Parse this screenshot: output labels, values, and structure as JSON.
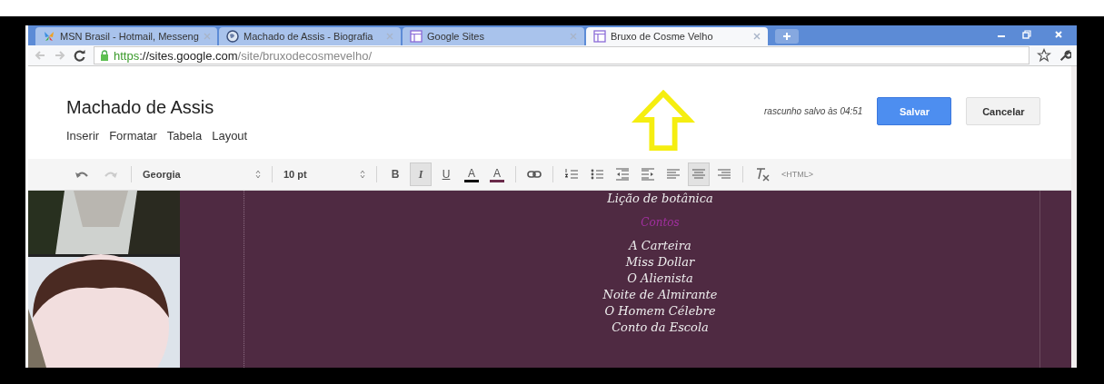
{
  "tabs": [
    {
      "title": "MSN Brasil - Hotmail, Messeng",
      "selected": false
    },
    {
      "title": "Machado de Assis - Biografia",
      "selected": false
    },
    {
      "title": "Google Sites",
      "selected": false
    },
    {
      "title": "Bruxo de Cosme Velho",
      "selected": true
    }
  ],
  "address": {
    "scheme": "https",
    "host": "://sites.google.com",
    "path": "/site/bruxodecosmevelho/"
  },
  "site_title": "Machado de Assis",
  "menu": [
    {
      "label": "Inserir"
    },
    {
      "label": "Formatar"
    },
    {
      "label": "Tabela"
    },
    {
      "label": "Layout"
    }
  ],
  "draft_status": "rascunho salvo às 04:51",
  "buttons": [
    {
      "label": "Salvar",
      "kind": "primary"
    },
    {
      "label": "Cancelar",
      "kind": "secondary"
    }
  ],
  "toolbar": {
    "font": "Georgia",
    "size": "10 pt",
    "html": "<HTML>",
    "tools": [
      {
        "kind": "bold",
        "label": "B",
        "selected": false
      },
      {
        "kind": "italic",
        "label": "I",
        "selected": true
      },
      {
        "kind": "underline",
        "label": "U",
        "selected": false
      },
      {
        "kind": "color",
        "label": "A",
        "selected": false
      },
      {
        "kind": "highlight",
        "label": "A",
        "selected": false
      },
      {
        "kind": "link",
        "selected": false
      },
      {
        "kind": "numbered",
        "selected": false
      },
      {
        "kind": "bulleted",
        "selected": false
      },
      {
        "kind": "outdent",
        "selected": false
      },
      {
        "kind": "indent",
        "selected": false
      },
      {
        "kind": "left",
        "selected": false
      },
      {
        "kind": "center",
        "selected": true
      },
      {
        "kind": "right",
        "selected": false
      },
      {
        "kind": "clear",
        "selected": false
      }
    ]
  },
  "content": [
    {
      "text": "Lição de botânica",
      "kind": "item"
    },
    {
      "text": "Contos",
      "kind": "heading"
    },
    {
      "text": "A Carteira",
      "kind": "item"
    },
    {
      "text": "Miss Dollar",
      "kind": "item"
    },
    {
      "text": "O Alienista",
      "kind": "item"
    },
    {
      "text": "Noite de Almirante",
      "kind": "item"
    },
    {
      "text": "O Homem Célebre",
      "kind": "item"
    },
    {
      "text": "Conto da Escola",
      "kind": "item"
    }
  ]
}
